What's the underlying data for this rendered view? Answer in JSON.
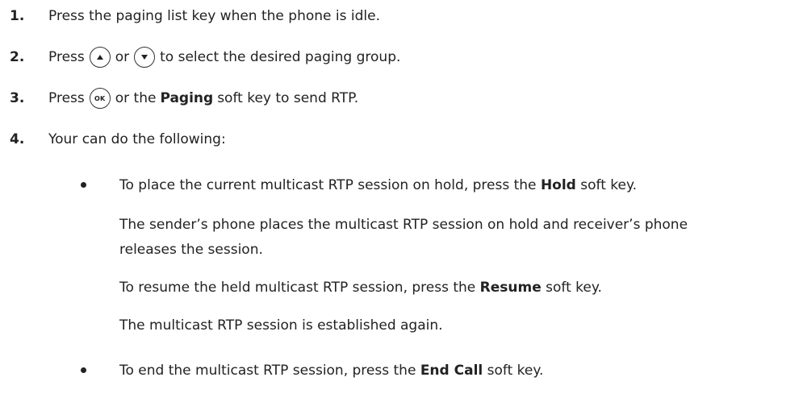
{
  "steps": [
    {
      "num": "1.",
      "text": "Press the paging list key when the phone is idle."
    },
    {
      "num": "2.",
      "pre": "Press",
      "mid": "or",
      "post": "to select the desired paging group."
    },
    {
      "num": "3.",
      "pre": "Press",
      "mid": "or the",
      "bold": "Paging",
      "post": "soft key to send RTP."
    },
    {
      "num": "4.",
      "text": "Your can do the following:"
    }
  ],
  "icons": {
    "up": "up-arrow-key-icon",
    "down": "down-arrow-key-icon",
    "ok": "ok-key-icon",
    "ok_label": "OK"
  },
  "bullets": [
    {
      "pre": "To place the current multicast RTP session on hold, press the",
      "bold": "Hold",
      "post": "soft key.",
      "paragraphs": [
        "The sender’s phone places the multicast RTP session on hold and receiver’s phone",
        "releases the session.",
        {
          "pre": "To resume the held multicast RTP session, press the",
          "bold": "Resume",
          "post": "soft key."
        },
        "The multicast RTP session is established again."
      ]
    },
    {
      "pre": "To end the multicast RTP session, press the",
      "bold": "End Call",
      "post": "soft key."
    }
  ]
}
